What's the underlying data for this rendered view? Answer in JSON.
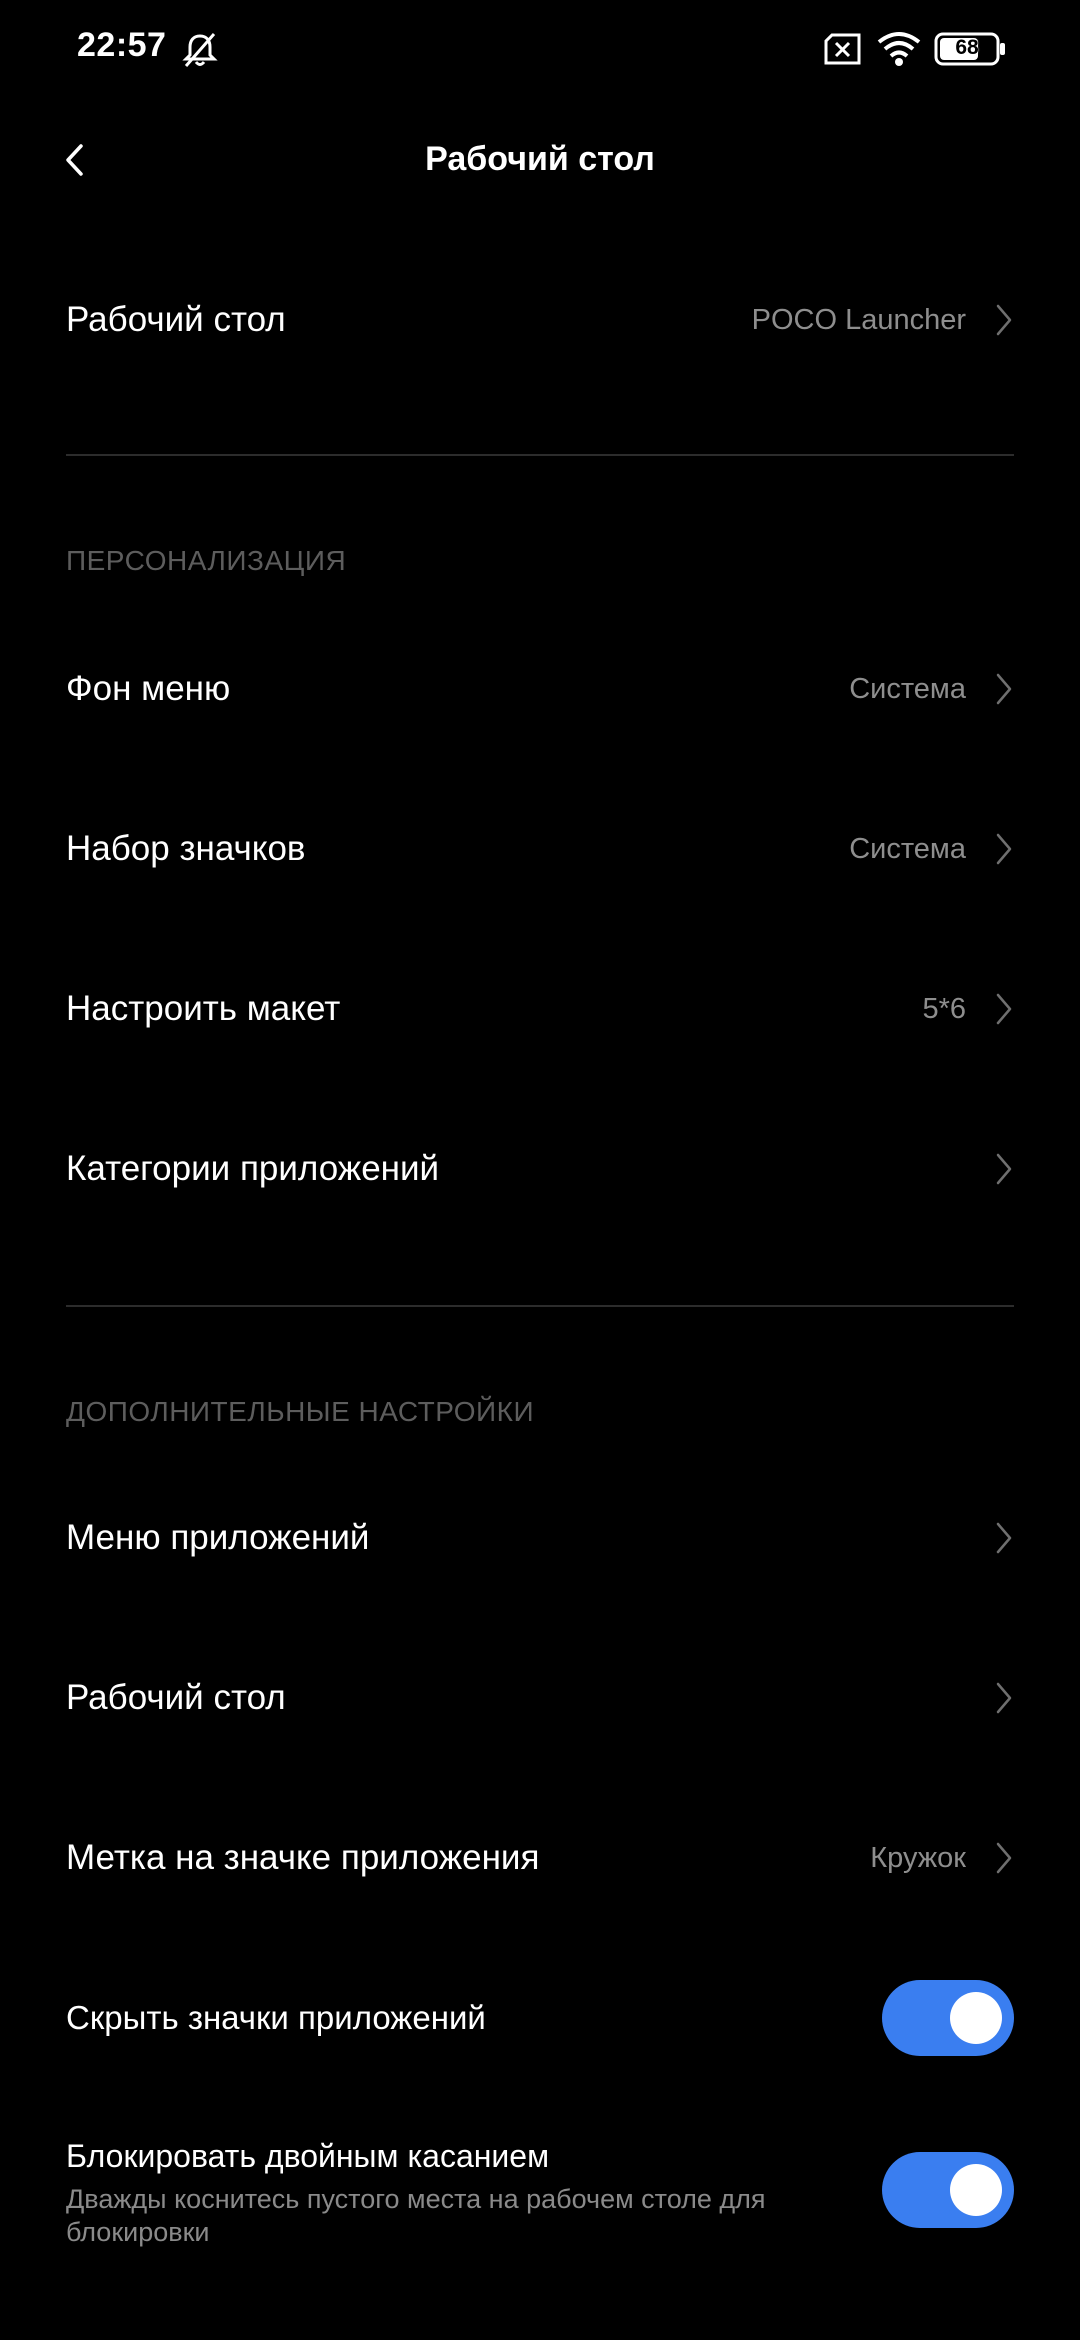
{
  "status_bar": {
    "time": "22:57",
    "battery": "68",
    "icons": [
      "bell-off-icon",
      "sim-x-icon",
      "wifi-icon",
      "battery-icon"
    ]
  },
  "header": {
    "title": "Рабочий стол",
    "back_icon": "chevron-left-icon"
  },
  "launcher_row": {
    "label": "Рабочий стол",
    "value": "POCO Launcher"
  },
  "section_personalization": {
    "title": "ПЕРСОНАЛИЗАЦИЯ",
    "items": [
      {
        "label": "Фон меню",
        "value": "Система"
      },
      {
        "label": "Набор значков",
        "value": "Система"
      },
      {
        "label": "Настроить макет",
        "value": "5*6"
      },
      {
        "label": "Категории приложений",
        "value": ""
      }
    ]
  },
  "section_advanced": {
    "title": "ДОПОЛНИТЕЛЬНЫЕ НАСТРОЙКИ",
    "items": [
      {
        "label": "Меню приложений",
        "value": ""
      },
      {
        "label": "Рабочий стол",
        "value": ""
      },
      {
        "label": "Метка на значке приложения",
        "value": "Кружок"
      }
    ],
    "toggles": [
      {
        "label": "Скрыть значки приложений",
        "on": true
      },
      {
        "label": "Блокировать двойным касанием",
        "subtitle": "Дважды коснитесь пустого места на рабочем столе для блокировки",
        "on": true
      }
    ]
  },
  "colors": {
    "background": "#000000",
    "accent": "#3a7ef0",
    "secondary_text": "#8e8e8e",
    "section_header": "#5d5d5d"
  }
}
